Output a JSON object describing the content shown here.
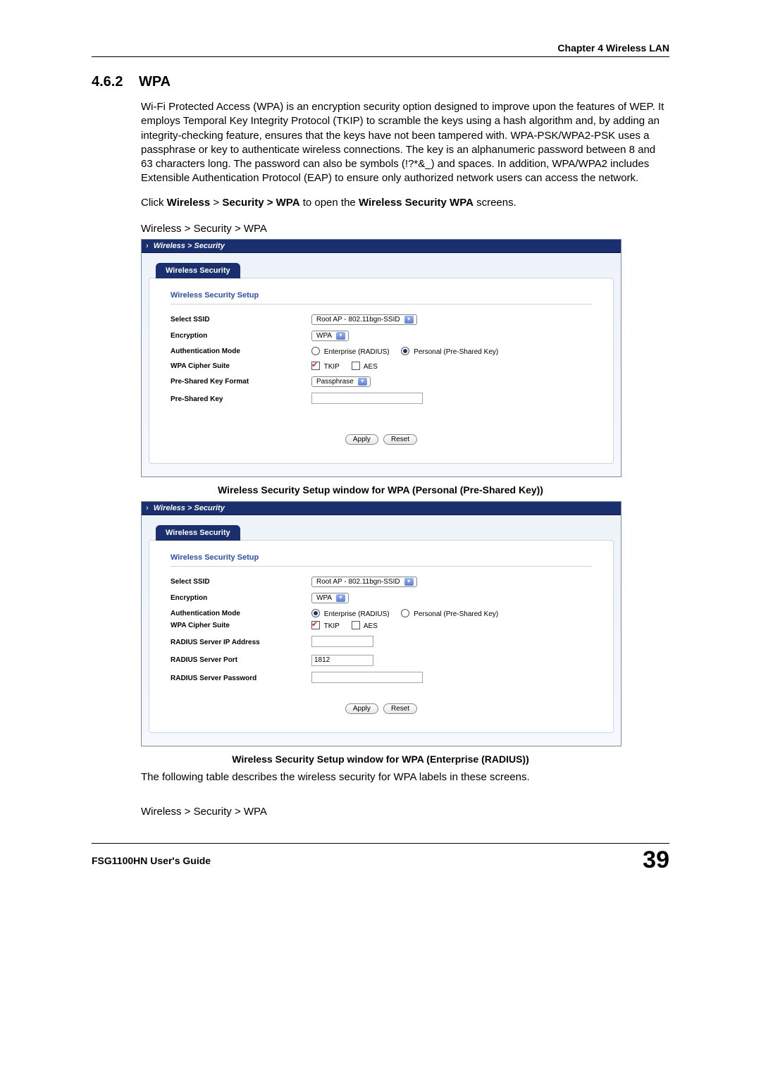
{
  "header": {
    "chapter": "Chapter 4 Wireless LAN"
  },
  "section": {
    "number": "4.6.2",
    "title": "WPA"
  },
  "paragraphs": {
    "p1": "Wi-Fi Protected Access (WPA) is an encryption security option designed to improve upon the features of WEP. It employs Temporal Key Integrity Protocol (TKIP) to scramble the keys using a hash algorithm and, by adding an integrity-checking feature, ensures that the keys have not been tampered with. WPA-PSK/WPA2-PSK uses a passphrase or key to authenticate wireless connections. The key is an alphanumeric password between 8 and 63 characters long. The password can also be symbols (!?*&_) and spaces. In addition, WPA/WPA2 includes Extensible Authentication Protocol (EAP) to ensure only authorized network users can access the network.",
    "p2_pre": "Click ",
    "p2_b1": "Wireless",
    "p2_mid1": " > ",
    "p2_b2": "Security > WPA",
    "p2_mid2": " to open the ",
    "p2_b3": "Wireless Security WPA",
    "p2_post": " screens.",
    "p3": "The following table describes the wireless security for WPA labels in these screens."
  },
  "captions": {
    "top": "Wireless > Security > WPA",
    "fig1": "Wireless Security Setup window for WPA (Personal (Pre-Shared Key))",
    "fig2": "Wireless Security Setup window for WPA (Enterprise (RADIUS))",
    "bottom": "Wireless > Security > WPA"
  },
  "ui": {
    "breadcrumb": "Wireless > Security",
    "tab": "Wireless Security",
    "panel_title": "Wireless Security Setup",
    "labels": {
      "ssid": "Select SSID",
      "enc": "Encryption",
      "auth": "Authentication Mode",
      "cipher": "WPA Cipher Suite",
      "pskfmt": "Pre-Shared Key Format",
      "psk": "Pre-Shared Key",
      "rip": "RADIUS Server IP Address",
      "rport": "RADIUS Server Port",
      "rpwd": "RADIUS Server Password"
    },
    "values": {
      "ssid": "Root AP - 802.11bgn-SSID",
      "enc": "WPA",
      "auth_enterprise": "Enterprise (RADIUS)",
      "auth_personal": "Personal (Pre-Shared Key)",
      "tkip": "TKIP",
      "aes": "AES",
      "pskfmt": "Passphrase",
      "rport": "1812"
    },
    "buttons": {
      "apply": "Apply",
      "reset": "Reset"
    }
  },
  "footer": {
    "guide": "FSG1100HN User's Guide",
    "page": "39"
  }
}
